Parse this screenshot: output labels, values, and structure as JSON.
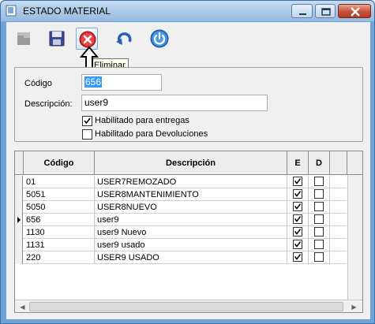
{
  "window": {
    "title": "ESTADO MATERIAL"
  },
  "toolbar": {
    "items": [
      {
        "name": "new",
        "icon": "flag-icon"
      },
      {
        "name": "save",
        "icon": "save-icon"
      },
      {
        "name": "delete",
        "icon": "delete-icon"
      },
      {
        "name": "undo",
        "icon": "undo-icon"
      },
      {
        "name": "exit",
        "icon": "power-icon"
      }
    ],
    "tooltip": "Eliminar"
  },
  "form": {
    "codigo_label": "Código",
    "codigo_value": "656",
    "descripcion_label": "Descripción:",
    "descripcion_value": "user9",
    "entregas_label": "Habilitado para entregas",
    "entregas_checked": true,
    "devoluciones_label": "Habilitado para Devoluciones",
    "devoluciones_checked": false
  },
  "grid": {
    "columns": [
      "Código",
      "Descripción",
      "E",
      "D"
    ],
    "rows": [
      {
        "codigo": "01",
        "descripcion": "USER7REMOZADO",
        "e": true,
        "d": false,
        "current": false
      },
      {
        "codigo": "5051",
        "descripcion": "USER8MANTENIMIENTO",
        "e": true,
        "d": false,
        "current": false
      },
      {
        "codigo": "5050",
        "descripcion": "USER8NUEVO",
        "e": true,
        "d": false,
        "current": false
      },
      {
        "codigo": "656",
        "descripcion": "user9",
        "e": true,
        "d": false,
        "current": true
      },
      {
        "codigo": "1130",
        "descripcion": "user9 Nuevo",
        "e": true,
        "d": false,
        "current": false
      },
      {
        "codigo": "1131",
        "descripcion": "user9 usado",
        "e": true,
        "d": false,
        "current": false
      },
      {
        "codigo": "220",
        "descripcion": "USER9 USADO",
        "e": true,
        "d": false,
        "current": false
      }
    ]
  }
}
